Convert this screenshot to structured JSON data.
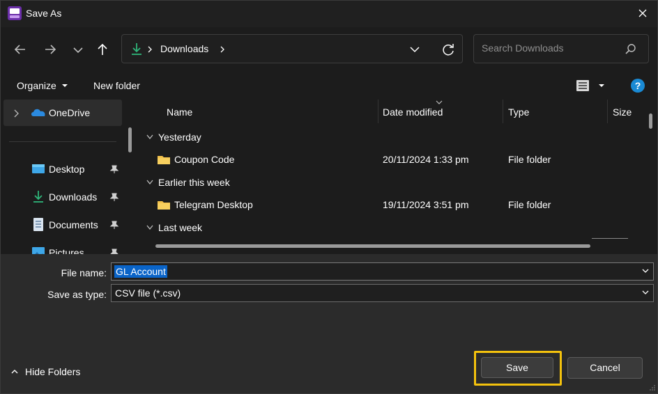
{
  "window": {
    "title": "Save As"
  },
  "address": {
    "path": "Downloads"
  },
  "search": {
    "placeholder": "Search Downloads"
  },
  "commands": {
    "organize": "Organize",
    "new_folder": "New folder"
  },
  "sidebar": {
    "items": [
      {
        "label": "OneDrive",
        "icon": "onedrive-icon",
        "pinned": false
      },
      {
        "label": "Desktop",
        "icon": "desktop-icon",
        "pinned": true
      },
      {
        "label": "Downloads",
        "icon": "download-icon",
        "pinned": true
      },
      {
        "label": "Documents",
        "icon": "documents-icon",
        "pinned": true
      },
      {
        "label": "Pictures",
        "icon": "pictures-icon",
        "pinned": true
      }
    ]
  },
  "columns": {
    "name": "Name",
    "date": "Date modified",
    "type": "Type",
    "size": "Size"
  },
  "groups": [
    {
      "label": "Yesterday",
      "files": [
        {
          "name": "Coupon Code",
          "date": "20/11/2024 1:33 pm",
          "type": "File folder"
        }
      ]
    },
    {
      "label": "Earlier this week",
      "files": [
        {
          "name": "Telegram Desktop",
          "date": "19/11/2024 3:51 pm",
          "type": "File folder"
        }
      ]
    },
    {
      "label": "Last week",
      "files": []
    }
  ],
  "form": {
    "file_name_label": "File name:",
    "file_name_value": "GL Account",
    "type_label": "Save as type:",
    "type_value": "CSV file (*.csv)"
  },
  "footer": {
    "hide_folders": "Hide Folders",
    "save": "Save",
    "cancel": "Cancel"
  },
  "colors": {
    "accent": "#0a64c8",
    "highlight": "#f4c20d",
    "folder": "#f2c14b",
    "help": "#1a8ad4"
  }
}
